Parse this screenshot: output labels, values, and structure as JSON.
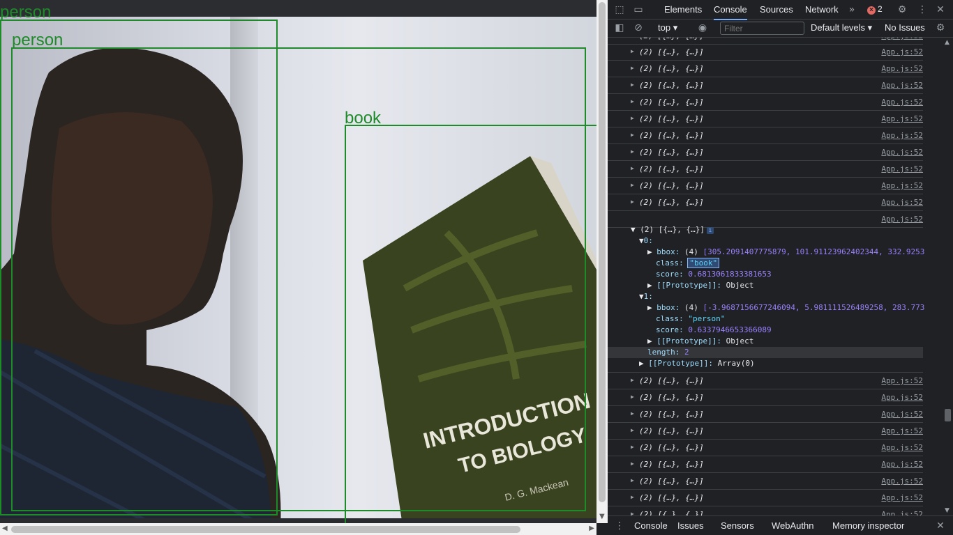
{
  "page": {
    "detections": [
      {
        "label": "person"
      },
      {
        "label": "person"
      },
      {
        "label": "book"
      }
    ],
    "book_text": {
      "line1": "INTRODUCTION",
      "line2": "TO BIOLOGY",
      "author": "D. G. Mackean"
    }
  },
  "devtools": {
    "tabs": [
      "Elements",
      "Console",
      "Sources",
      "Network"
    ],
    "more_tabs_icon": "double-chevron-right",
    "error_count": "2",
    "toolbar": {
      "context": "top",
      "filter_placeholder": "Filter",
      "levels": "Default levels",
      "issues": "No Issues"
    },
    "collapsed_row_text": "(2) [{…}, {…}]",
    "source_link": "App.js:52",
    "expanded": {
      "header": "(2) [{…}, {…}]",
      "item0": {
        "index": "0:",
        "bbox_key": "bbox:",
        "bbox_count": "(4)",
        "bbox_values": "[305.2091407775879, 101.91123962402344, 332.9253",
        "class_key": "class:",
        "class_value": "\"book\"",
        "score_key": "score:",
        "score_value": "0.6813061833381653",
        "proto": "[[Prototype]]:",
        "proto_value": "Object"
      },
      "item1": {
        "index": "1:",
        "bbox_key": "bbox:",
        "bbox_count": "(4)",
        "bbox_values": "[-3.9687156677246094, 5.981111526489258, 283.773",
        "class_key": "class:",
        "class_value": "\"person\"",
        "score_key": "score:",
        "score_value": "0.6337946653366089",
        "proto": "[[Prototype]]:",
        "proto_value": "Object"
      },
      "length_key": "length:",
      "length_value": "2",
      "array_proto": "[[Prototype]]:",
      "array_proto_value": "Array(0)"
    },
    "drawer_tabs": [
      "Console",
      "Issues",
      "Sensors",
      "WebAuthn",
      "Memory inspector"
    ]
  }
}
